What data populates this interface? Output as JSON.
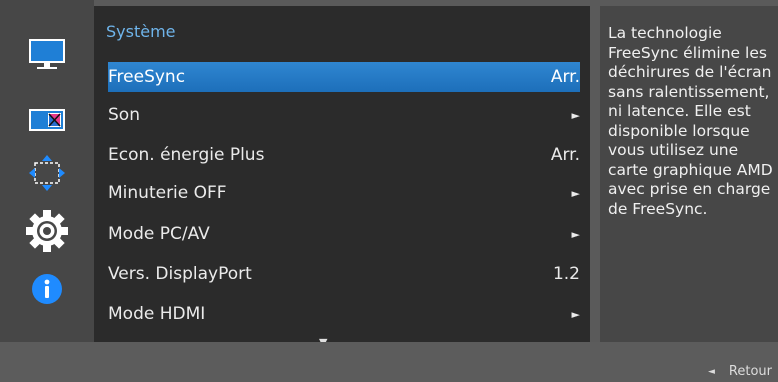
{
  "categories": [
    {
      "icon": "monitor-icon"
    },
    {
      "icon": "color-icon"
    },
    {
      "icon": "size-position-icon"
    },
    {
      "icon": "gear-icon"
    },
    {
      "icon": "info-icon"
    }
  ],
  "panel": {
    "title": "Système",
    "items": [
      {
        "label": "FreeSync",
        "value": "Arr."
      },
      {
        "label": "Son",
        "value": "►"
      },
      {
        "label": "Econ. énergie Plus",
        "value": "Arr."
      },
      {
        "label": "Minuterie OFF",
        "value": "►"
      },
      {
        "label": "Mode PC/AV",
        "value": "►"
      },
      {
        "label": "Vers. DisplayPort",
        "value": "1.2"
      },
      {
        "label": "Mode HDMI",
        "value": "►"
      }
    ],
    "scroll_hint": "▼"
  },
  "description": "La technologie FreeSync élimine les déchirures de l'écran sans ralentissement, ni latence. Elle est disponible lorsque vous utilisez une carte graphique AMD avec prise en charge de FreeSync.",
  "footer": {
    "return_arrow": "◄",
    "return_label": "Retour"
  },
  "colors": {
    "accent": "#1d6fba",
    "title": "#6fb4ea",
    "panel": "#2b2b2b",
    "sidebar": "#474747"
  }
}
